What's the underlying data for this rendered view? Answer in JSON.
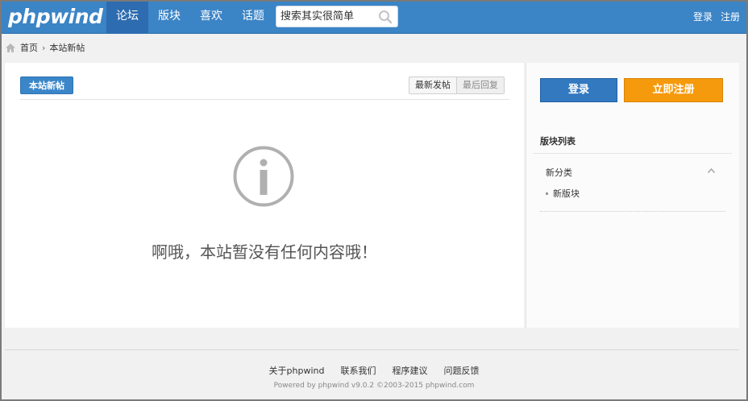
{
  "header": {
    "logo": "phpwind",
    "nav": [
      "论坛",
      "版块",
      "喜欢",
      "话题"
    ],
    "search": {
      "placeholder": "搜索其实很简单"
    },
    "login": "登录",
    "register": "注册"
  },
  "breadcrumb": {
    "home": "首页",
    "sep": "›",
    "current": "本站新帖"
  },
  "main": {
    "tab_label": "本站新帖",
    "sort": [
      "最新发帖",
      "最后回复"
    ],
    "empty_message": "啊哦，本站暂没有任何内容哦！"
  },
  "sidebar": {
    "login_button": "登录",
    "register_button": "立即注册",
    "section_title": "版块列表",
    "category": "新分类",
    "forum": "新版块"
  },
  "footer": {
    "links": [
      "关于phpwind",
      "联系我们",
      "程序建议",
      "问题反馈"
    ],
    "copyright": "Powered by phpwind v9.0.2 ©2003-2015 phpwind.com"
  },
  "colors": {
    "brand": "#3b84c6",
    "nav_active": "#2d6cb0",
    "login_btn": "#3279c0",
    "register_btn": "#f59a0c"
  },
  "icons": [
    "search-icon",
    "home-icon",
    "info-icon",
    "chevron-up-icon"
  ]
}
